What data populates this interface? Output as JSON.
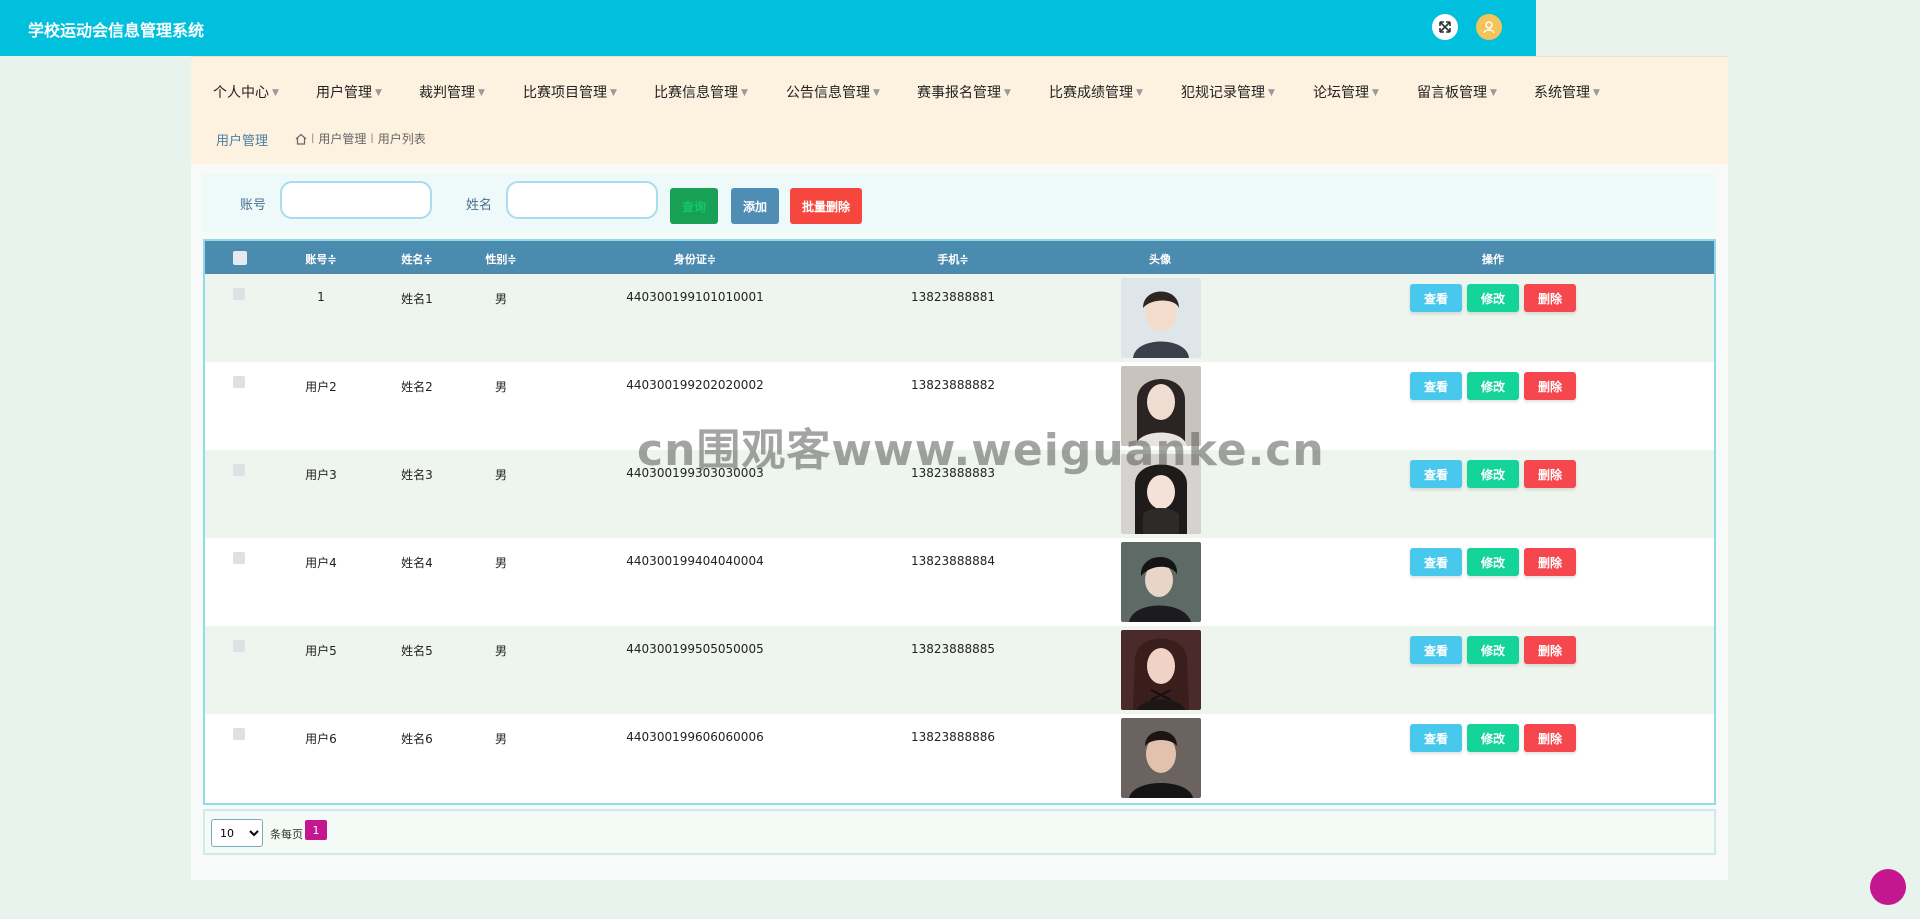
{
  "header": {
    "app_title": "学校运动会信息管理系统",
    "fullscreen_icon": "expand-arrows-icon",
    "user_icon": "user-avatar-icon"
  },
  "nav": {
    "items": [
      {
        "label": "个人中心"
      },
      {
        "label": "用户管理"
      },
      {
        "label": "裁判管理"
      },
      {
        "label": "比赛项目管理"
      },
      {
        "label": "比赛信息管理"
      },
      {
        "label": "公告信息管理"
      },
      {
        "label": "赛事报名管理"
      },
      {
        "label": "比赛成绩管理"
      },
      {
        "label": "犯规记录管理"
      },
      {
        "label": "论坛管理"
      },
      {
        "label": "留言板管理"
      },
      {
        "label": "系统管理"
      }
    ]
  },
  "breadcrumb": {
    "title": "用户管理",
    "home_icon": "home-icon",
    "separator": "l",
    "path": [
      "用户管理",
      "用户列表"
    ]
  },
  "search": {
    "account_label": "账号",
    "account_value": "",
    "name_label": "姓名",
    "name_value": "",
    "search_button": "查询",
    "add_button": "添加",
    "batch_delete_button": "批量删除"
  },
  "table": {
    "columns": [
      "账号",
      "姓名",
      "性别",
      "身份证",
      "手机",
      "头像",
      "操作"
    ],
    "sort_icon": "≑",
    "rows": [
      {
        "account": "1",
        "name": "姓名1",
        "gender": "男",
        "id_card": "440300199101010001",
        "phone": "13823888881"
      },
      {
        "account": "用户2",
        "name": "姓名2",
        "gender": "男",
        "id_card": "440300199202020002",
        "phone": "13823888882"
      },
      {
        "account": "用户3",
        "name": "姓名3",
        "gender": "男",
        "id_card": "440300199303030003",
        "phone": "13823888883"
      },
      {
        "account": "用户4",
        "name": "姓名4",
        "gender": "男",
        "id_card": "440300199404040004",
        "phone": "13823888884"
      },
      {
        "account": "用户5",
        "name": "姓名5",
        "gender": "男",
        "id_card": "440300199505050005",
        "phone": "13823888885"
      },
      {
        "account": "用户6",
        "name": "姓名6",
        "gender": "男",
        "id_card": "440300199606060006",
        "phone": "13823888886"
      }
    ],
    "actions": {
      "view": "查看",
      "edit": "修改",
      "delete": "删除"
    }
  },
  "pagination": {
    "page_size": "10",
    "page_size_label": "条每页",
    "current_page": "1"
  },
  "watermark": "cn围观客www.weiguanke.cn",
  "colors": {
    "topbar": "#00c0de",
    "menubar": "#fdf1df",
    "table_header": "#4c8bb0",
    "view_button": "#49c8ee",
    "edit_button": "#15d49a",
    "delete_button": "#f5474d",
    "pager_active": "#c4178f"
  }
}
